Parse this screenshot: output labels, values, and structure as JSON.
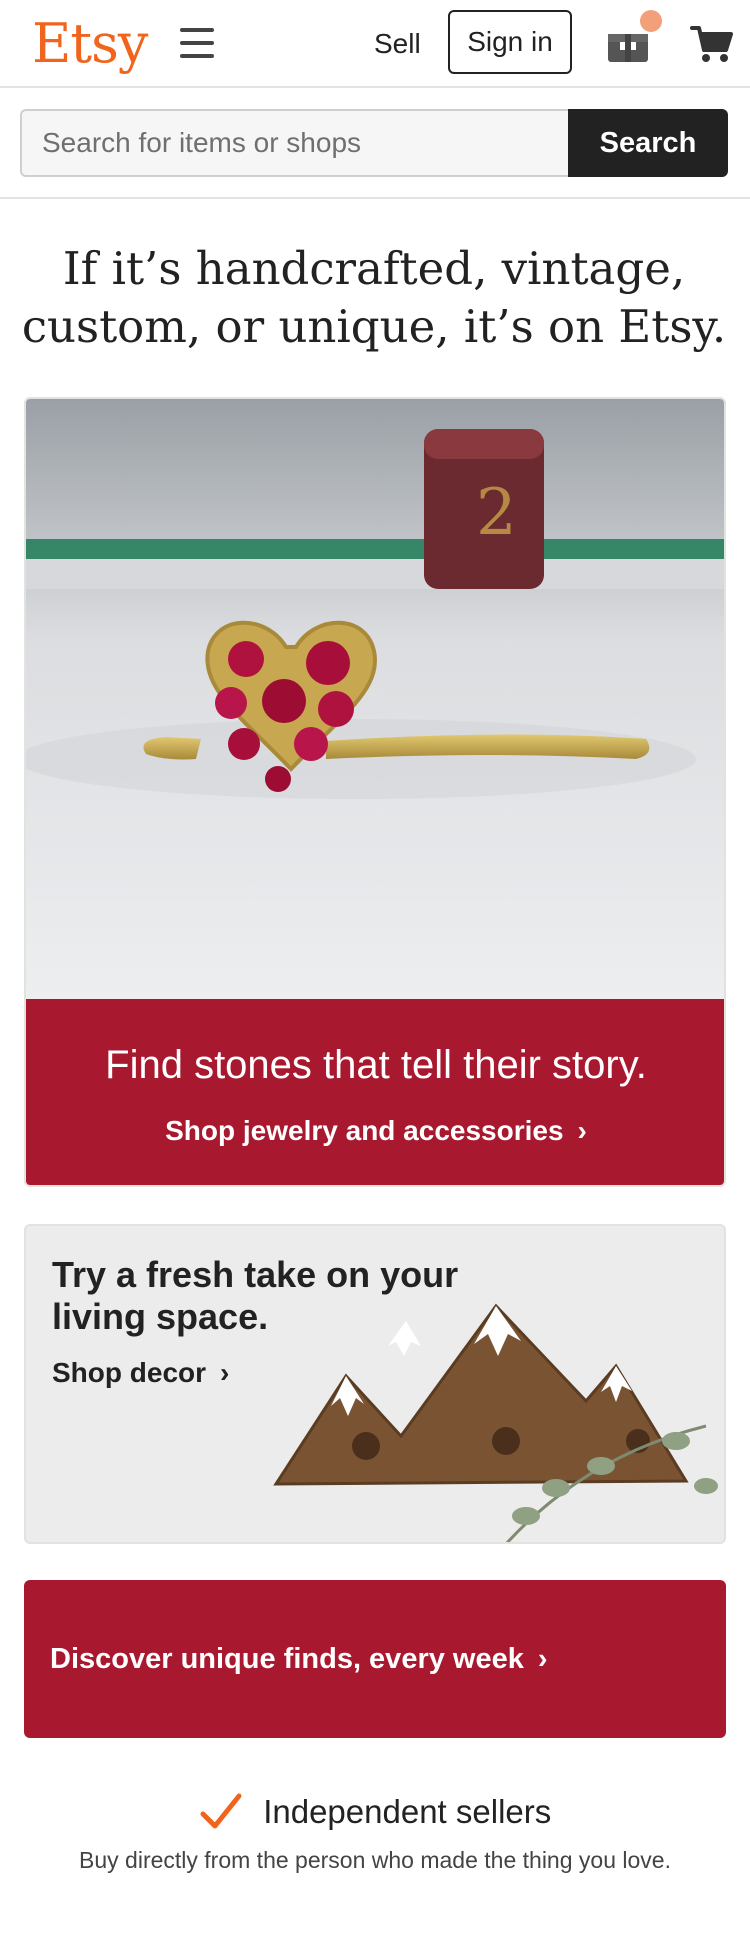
{
  "header": {
    "logo": "Etsy",
    "sell_label": "Sell",
    "signin_label": "Sign in",
    "logo_color": "#f1641e"
  },
  "search": {
    "placeholder": "Search for items or shops",
    "button_label": "Search"
  },
  "tagline": "If it’s handcrafted, vintage, custom, or unique, it’s on Etsy.",
  "hero": {
    "title": "Find stones that tell their story.",
    "link_label": "Shop jewelry and accessories",
    "band_color": "#a8182e"
  },
  "decor": {
    "title": "Try a fresh take on your living space.",
    "link_label": "Shop decor"
  },
  "discover": {
    "label": "Discover unique finds, every week"
  },
  "values": {
    "title": "Independent sellers",
    "description": "Buy directly from the person who made the thing you love.",
    "check_color": "#f1641e"
  },
  "icons": {
    "menu": "hamburger-menu-icon",
    "gift": "gift-box-icon",
    "cart": "shopping-cart-icon",
    "chevron": "chevron-right-icon",
    "check": "checkmark-icon"
  }
}
